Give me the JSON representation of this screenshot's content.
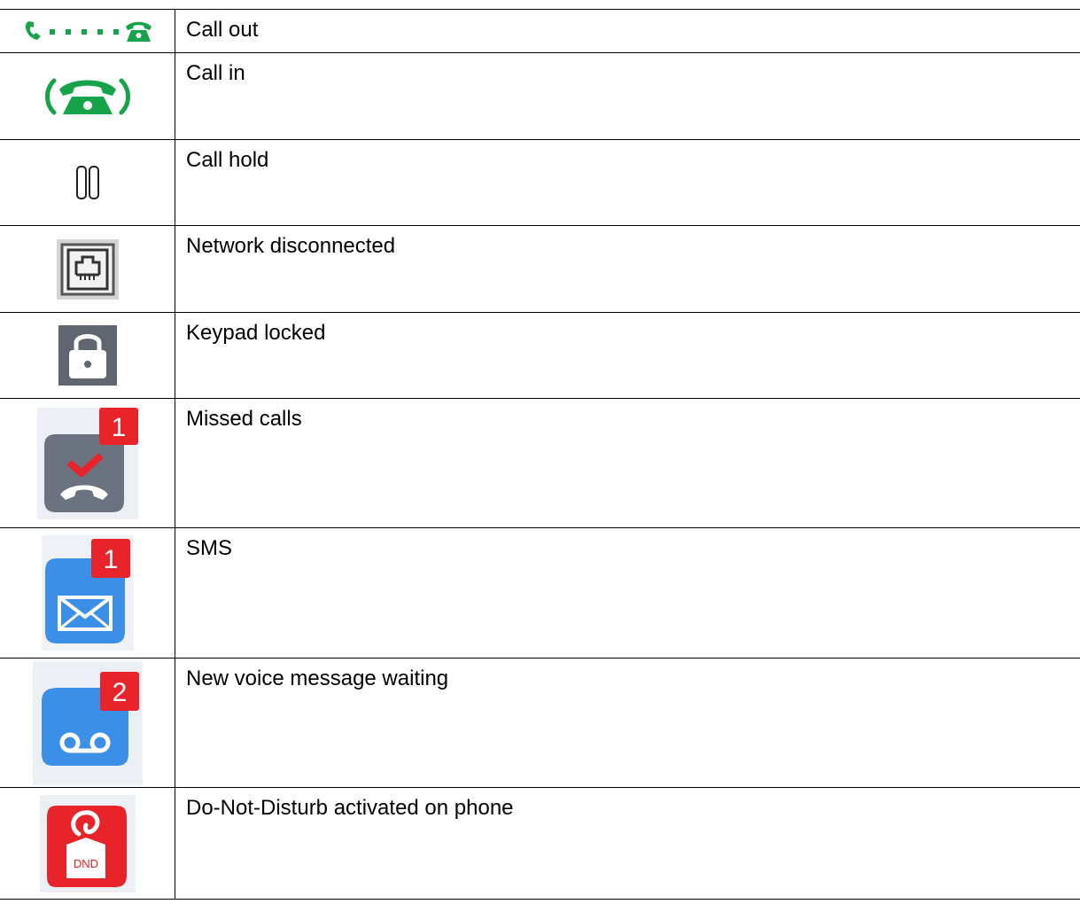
{
  "rows": [
    {
      "icon": "call-out-icon",
      "label": "Call out"
    },
    {
      "icon": "call-in-icon",
      "label": "Call in"
    },
    {
      "icon": "call-hold-icon",
      "label": "Call hold"
    },
    {
      "icon": "network-disconnected-icon",
      "label": "Network disconnected"
    },
    {
      "icon": "keypad-locked-icon",
      "label": "Keypad locked"
    },
    {
      "icon": "missed-calls-icon",
      "label": "Missed calls",
      "badge": "1"
    },
    {
      "icon": "sms-icon",
      "label": "SMS",
      "badge": "1"
    },
    {
      "icon": "voice-message-icon",
      "label": "New voice message waiting",
      "badge": "2"
    },
    {
      "icon": "dnd-icon",
      "label": "Do-Not-Disturb activated on phone",
      "icon_text": "DND"
    }
  ],
  "colors": {
    "phone_green": "#16a34a",
    "badge_red": "#e8242a",
    "tile_gray": "#6b7280",
    "tile_blue": "#3b8fe6",
    "dnd_red": "#e8242a"
  }
}
